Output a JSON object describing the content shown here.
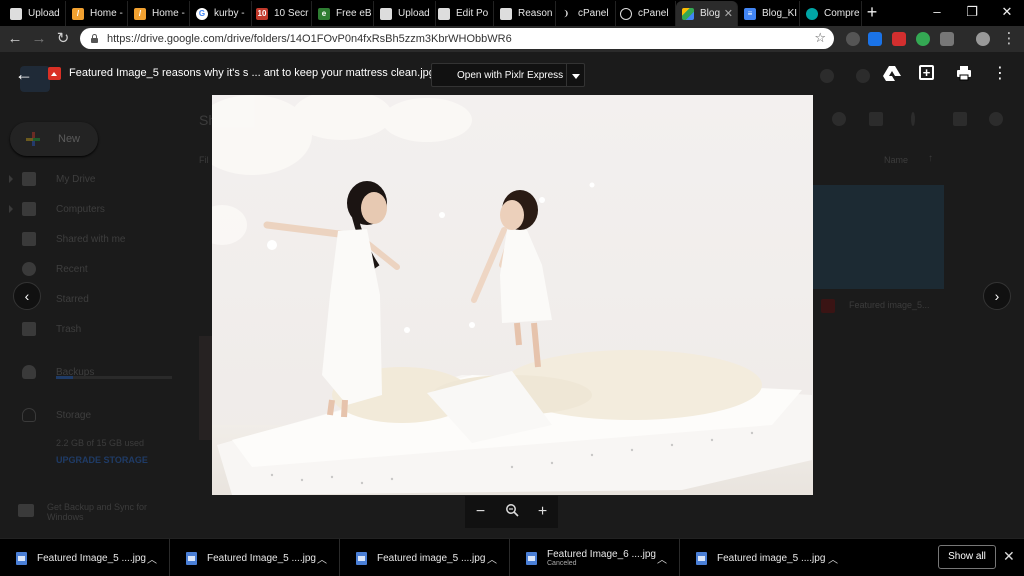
{
  "browser": {
    "tabs": [
      {
        "label": "Upload",
        "icon": "page-icon",
        "color": "#dddddd"
      },
      {
        "label": "Home -",
        "icon": "wp-icon",
        "color": "#f0a030"
      },
      {
        "label": "Home -",
        "icon": "wp-icon",
        "color": "#f0a030"
      },
      {
        "label": "kurby -",
        "icon": "google-icon",
        "color": "#4285f4"
      },
      {
        "label": "10 Secr",
        "icon": "site-icon",
        "color": "#c0392b"
      },
      {
        "label": "Free eB",
        "icon": "site-icon",
        "color": "#2e7d32"
      },
      {
        "label": "Upload",
        "icon": "page-icon",
        "color": "#dddddd"
      },
      {
        "label": "Edit Po",
        "icon": "page-icon",
        "color": "#dddddd"
      },
      {
        "label": "Reason",
        "icon": "page-icon",
        "color": "#dddddd"
      },
      {
        "label": "cPanel",
        "icon": "cpanel-icon",
        "color": "#dddddd"
      },
      {
        "label": "cPanel",
        "icon": "cpanel-icon",
        "color": "#dddddd"
      },
      {
        "label": "Blog",
        "icon": "drive-icon",
        "color": "#fbbc04",
        "active": true
      },
      {
        "label": "Blog_KI",
        "icon": "docs-icon",
        "color": "#4285f4"
      },
      {
        "label": "Compre",
        "icon": "site-icon",
        "color": "#00a5a5"
      }
    ],
    "url": "https://drive.google.com/drive/folders/14O1FOvP0n4fxRsBh5zzm3KbrWHObbWR6"
  },
  "drive_background": {
    "new_label": "New",
    "nav": [
      "My Drive",
      "Computers",
      "Shared with me",
      "Recent",
      "Starred",
      "Trash",
      "Backups",
      "Storage"
    ],
    "storage_used": "2.2 GB of 15 GB used",
    "storage_fraction": 0.15,
    "upgrade": "UPGRADE STORAGE",
    "backup_sync": "Get Backup and Sync for Windows",
    "list_header_sh": "Sh",
    "list_header_fi": "Fil",
    "sort_label": "Name",
    "file_label": "Featured image_5..."
  },
  "viewer": {
    "file_title": "Featured Image_5 reasons why it's s ... ant to keep your mattress clean.jpg",
    "open_with": "Open with Pixlr Express",
    "zoom_out": "−",
    "zoom_in": "+"
  },
  "downloads": [
    {
      "name": "Featured Image_5 ....jpg",
      "status": ""
    },
    {
      "name": "Featured Image_5 ....jpg",
      "status": ""
    },
    {
      "name": "Featured image_5 ....jpg",
      "status": ""
    },
    {
      "name": "Featured Image_6 ....jpg",
      "status": "Canceled"
    },
    {
      "name": "Featured image_5 ....jpg",
      "status": ""
    }
  ],
  "show_all": "Show all"
}
